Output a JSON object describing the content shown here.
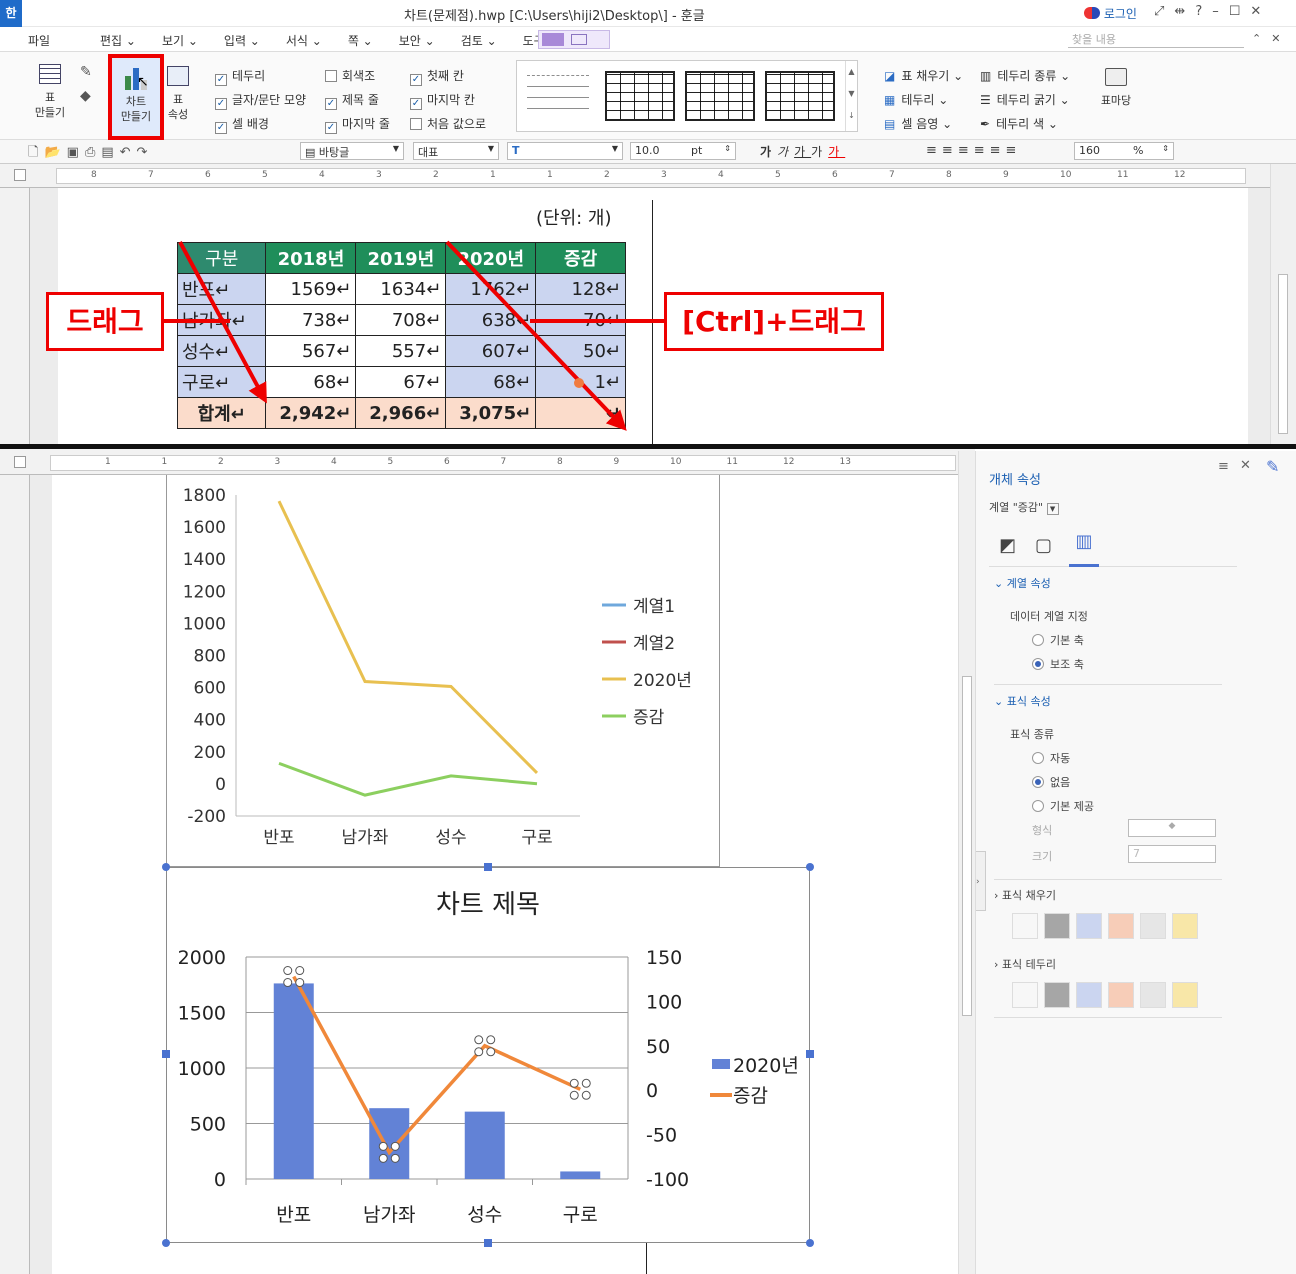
{
  "window": {
    "title": "차트(문제점).hwp [C:\\Users\\hiji2\\Desktop\\] - 훈글",
    "login": "로그인",
    "app_icon": "한"
  },
  "menu": {
    "file": "파일",
    "items": [
      "편집",
      "보기",
      "입력",
      "서식",
      "쪽",
      "보안",
      "검토",
      "도구"
    ],
    "search_placeholder": "찾을 내용"
  },
  "ribbon": {
    "table_make": "표\n만들기",
    "chart_make": "차트\n만들기",
    "table_props": "표\n속성",
    "checks_col1": [
      {
        "label": "테두리",
        "checked": true
      },
      {
        "label": "글자/문단 모양",
        "checked": true
      },
      {
        "label": "셀 배경",
        "checked": true
      }
    ],
    "checks_col2": [
      {
        "label": "회색조",
        "checked": false
      },
      {
        "label": "제목 줄",
        "checked": true
      },
      {
        "label": "마지막 줄",
        "checked": true
      }
    ],
    "checks_col3": [
      {
        "label": "첫째 칸",
        "checked": true
      },
      {
        "label": "마지막 칸",
        "checked": true
      },
      {
        "label": "처음 값으로",
        "checked": false
      }
    ],
    "cell_tools": [
      "표 채우기",
      "테두리",
      "셀 음영"
    ],
    "border_tools": [
      "테두리 종류",
      "테두리 굵기",
      "테두리 색"
    ],
    "table_mark": "표마당"
  },
  "format": {
    "style": "바탕글",
    "font_lang": "대표",
    "font": "",
    "size": "10.0",
    "unit": "pt",
    "zoom": "160",
    "zoom_unit": "%"
  },
  "top_ruler": [
    "8",
    "7",
    "6",
    "5",
    "4",
    "3",
    "2",
    "1",
    "1",
    "2",
    "3",
    "4",
    "5",
    "6",
    "7",
    "8",
    "9",
    "10",
    "11",
    "12"
  ],
  "bottom_ruler": [
    "1",
    "1",
    "2",
    "3",
    "4",
    "5",
    "6",
    "7",
    "8",
    "9",
    "10",
    "11",
    "12",
    "13"
  ],
  "doc": {
    "unit_note": "(단위: 개)",
    "table": {
      "headers": [
        "구분",
        "2018년",
        "2019년",
        "2020년",
        "증감"
      ],
      "rows": [
        [
          "반포",
          "1569",
          "1634",
          "1762",
          "128"
        ],
        [
          "남가좌",
          "738",
          "708",
          "638",
          "70"
        ],
        [
          "성수",
          "567",
          "557",
          "607",
          "50"
        ],
        [
          "구로",
          "68",
          "67",
          "68",
          "1"
        ]
      ],
      "total": [
        "합계",
        "2,942",
        "2,966",
        "3,075",
        ""
      ]
    },
    "label_drag": "드래그",
    "label_ctrl_drag": "[Ctrl]+드래그"
  },
  "chart_data": [
    {
      "type": "line",
      "categories": [
        "반포",
        "남가좌",
        "성수",
        "구로"
      ],
      "series": [
        {
          "name": "계열1",
          "values": [],
          "color": "#6fa8dc"
        },
        {
          "name": "계열2",
          "values": [],
          "color": "#c0504d"
        },
        {
          "name": "2020년",
          "values": [
            1762,
            638,
            607,
            68
          ],
          "color": "#e8c050"
        },
        {
          "name": "증감",
          "values": [
            128,
            -70,
            50,
            1
          ],
          "color": "#8ccf5f"
        }
      ],
      "ylim": [
        -200,
        1800
      ],
      "yticks": [
        "1800",
        "1600",
        "1400",
        "1200",
        "1000",
        "800",
        "600",
        "400",
        "200",
        "0",
        "-200"
      ],
      "legend": "right"
    },
    {
      "type": "bar+line",
      "title": "차트 제목",
      "categories": [
        "반포",
        "남가좌",
        "성수",
        "구로"
      ],
      "series": [
        {
          "name": "2020년",
          "type": "bar",
          "values": [
            1762,
            638,
            607,
            68
          ],
          "color": "#6282d6",
          "axis": "primary"
        },
        {
          "name": "증감",
          "type": "line",
          "values": [
            128,
            -70,
            50,
            1
          ],
          "color": "#f0883a",
          "axis": "secondary"
        }
      ],
      "ylim": [
        0,
        2000
      ],
      "yticks": [
        "2000",
        "1500",
        "1000",
        "500",
        "0"
      ],
      "y2lim": [
        -100,
        150
      ],
      "y2ticks": [
        "150",
        "100",
        "50",
        "0",
        "-50",
        "-100"
      ],
      "legend": "right",
      "grid": true
    }
  ],
  "panel": {
    "title": "개체 속성",
    "series_select": "계열 \"증감\"",
    "series_props": "계열 속성",
    "data_series_label": "데이터 계열 지정",
    "axis_options": [
      {
        "label": "기본 축",
        "checked": false
      },
      {
        "label": "보조 축",
        "checked": true
      }
    ],
    "marker_props": "표식 속성",
    "marker_type_label": "표식 종류",
    "marker_options": [
      {
        "label": "자동",
        "checked": false
      },
      {
        "label": "없음",
        "checked": true
      },
      {
        "label": "기본 제공",
        "checked": false
      }
    ],
    "shape_label": "형식",
    "size_label": "크기",
    "size_value": "7",
    "marker_fill": "표식 채우기",
    "marker_border": "표식 테두리",
    "swatches": [
      "#f7f7f7",
      "#a6a6a6",
      "#cbd5f0",
      "#f7cdb8",
      "#e6e6e6",
      "#f8e7a8"
    ]
  }
}
